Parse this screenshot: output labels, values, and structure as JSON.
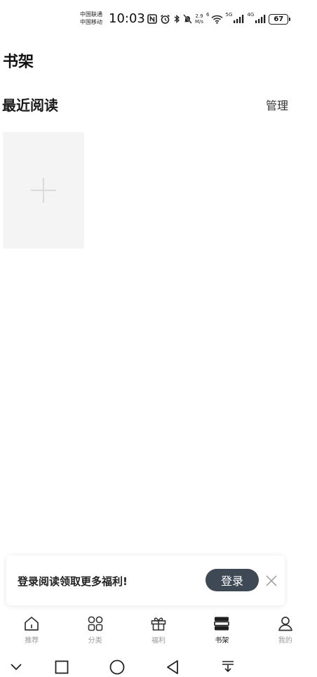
{
  "status_bar": {
    "carrier1": "中国联通",
    "carrier2": "中国移动",
    "time": "10:03",
    "speed_value": "2.9",
    "speed_unit": "M/s",
    "wifi_tag": "6",
    "net1_tag": "5G",
    "net2_tag": "4G",
    "battery": "67"
  },
  "header": {
    "title": "书架"
  },
  "recent": {
    "title": "最近阅读",
    "manage_label": "管理"
  },
  "login_banner": {
    "text": "登录阅读领取更多福利!",
    "button_label": "登录"
  },
  "tabs": [
    {
      "label": "推荐",
      "icon": "home-icon",
      "active": false
    },
    {
      "label": "分类",
      "icon": "grid-icon",
      "active": false
    },
    {
      "label": "福利",
      "icon": "gift-icon",
      "active": false
    },
    {
      "label": "书架",
      "icon": "bookshelf-icon",
      "active": true
    },
    {
      "label": "我的",
      "icon": "user-icon",
      "active": false
    }
  ],
  "colors": {
    "login_button": "#3f4955",
    "active_tab": "#111111",
    "inactive_tab": "#9a9a9a",
    "placeholder_bg": "#f4f4f4"
  }
}
